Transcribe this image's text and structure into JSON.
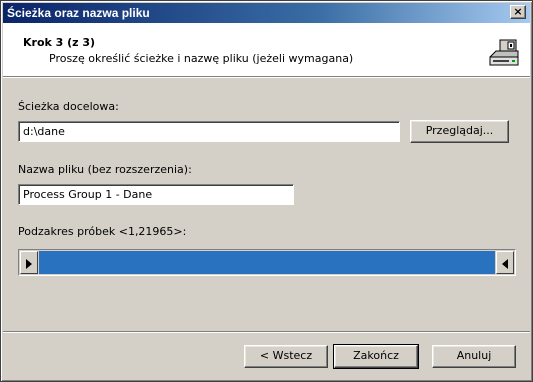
{
  "window": {
    "title": "Ścieżka oraz nazwa pliku",
    "close_glyph": "×"
  },
  "header": {
    "step": "Krok 3 (z 3)",
    "subtitle": "Proszę określić ścieżke i nazwę pliku (jeżeli wymagana)",
    "icon": "disk-drive-icon"
  },
  "path": {
    "label": "Ścieżka docelowa:",
    "value": "d:\\dane",
    "browse_label": "Przeglądaj..."
  },
  "filename": {
    "label": "Nazwa pliku (bez rozszerzenia):",
    "value": "Process Group 1 - Dane"
  },
  "range": {
    "label": "Podzakres próbek <1,21965>:",
    "min": 1,
    "max": 21965,
    "selected_from": 1,
    "selected_to": 21965,
    "fill_color": "#2872bf"
  },
  "buttons": {
    "back_label": "< Wstecz",
    "finish_label": "Zakończ",
    "cancel_label": "Anuluj"
  }
}
